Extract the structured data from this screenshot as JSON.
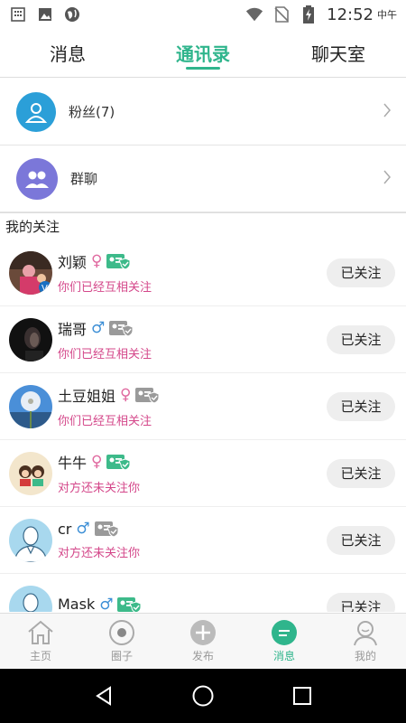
{
  "status_bar": {
    "time": "12:52",
    "period": "中午",
    "icons": [
      "calendar-icon",
      "image-icon",
      "globe-icon",
      "wifi-icon",
      "no-sim-icon",
      "battery-charging-icon"
    ]
  },
  "top_tabs": [
    {
      "label": "消息",
      "active": false
    },
    {
      "label": "通讯录",
      "active": true
    },
    {
      "label": "聊天室",
      "active": false
    }
  ],
  "entries": [
    {
      "label": "粉丝(7)",
      "icon": "person-icon",
      "color": "#2b9fd8"
    },
    {
      "label": "群聊",
      "icon": "group-icon",
      "color": "#7b77d9"
    }
  ],
  "section_title": "我的关注",
  "users": [
    {
      "name": "刘颖",
      "gender": "♀",
      "gender_type": "f",
      "status": "你们已经互相关注",
      "button": "已关注",
      "badge_color": "#3dba8a",
      "avatar": "photo-family"
    },
    {
      "name": "瑞哥",
      "gender": "♂",
      "gender_type": "m",
      "status": "你们已经互相关注",
      "button": "已关注",
      "badge_color": "#9a9a9a",
      "avatar": "photo-dark"
    },
    {
      "name": "土豆姐姐",
      "gender": "♀",
      "gender_type": "f",
      "status": "你们已经互相关注",
      "button": "已关注",
      "badge_color": "#9a9a9a",
      "avatar": "photo-dandelion"
    },
    {
      "name": "牛牛",
      "gender": "♀",
      "gender_type": "f",
      "status": "对方还未关注你",
      "button": "已关注",
      "badge_color": "#3dba8a",
      "avatar": "photo-cartoon"
    },
    {
      "name": "cr",
      "gender": "♂",
      "gender_type": "m",
      "status": "对方还未关注你",
      "button": "已关注",
      "badge_color": "#9a9a9a",
      "avatar": "default-avatar"
    },
    {
      "name": "Mask",
      "gender": "♂",
      "gender_type": "m",
      "status": "",
      "button": "已关注",
      "badge_color": "#3dba8a",
      "avatar": "default-avatar"
    }
  ],
  "bottom_nav": [
    {
      "label": "主页",
      "icon": "home-icon",
      "active": false
    },
    {
      "label": "圈子",
      "icon": "circle-icon",
      "active": false
    },
    {
      "label": "发布",
      "icon": "plus-icon",
      "active": false
    },
    {
      "label": "消息",
      "icon": "message-icon",
      "active": true
    },
    {
      "label": "我的",
      "icon": "profile-icon",
      "active": false
    }
  ],
  "colors": {
    "accent": "#2fb58c",
    "status_pink": "#d4478a",
    "male_blue": "#3d8fd6",
    "female_pink": "#e06aa0"
  }
}
